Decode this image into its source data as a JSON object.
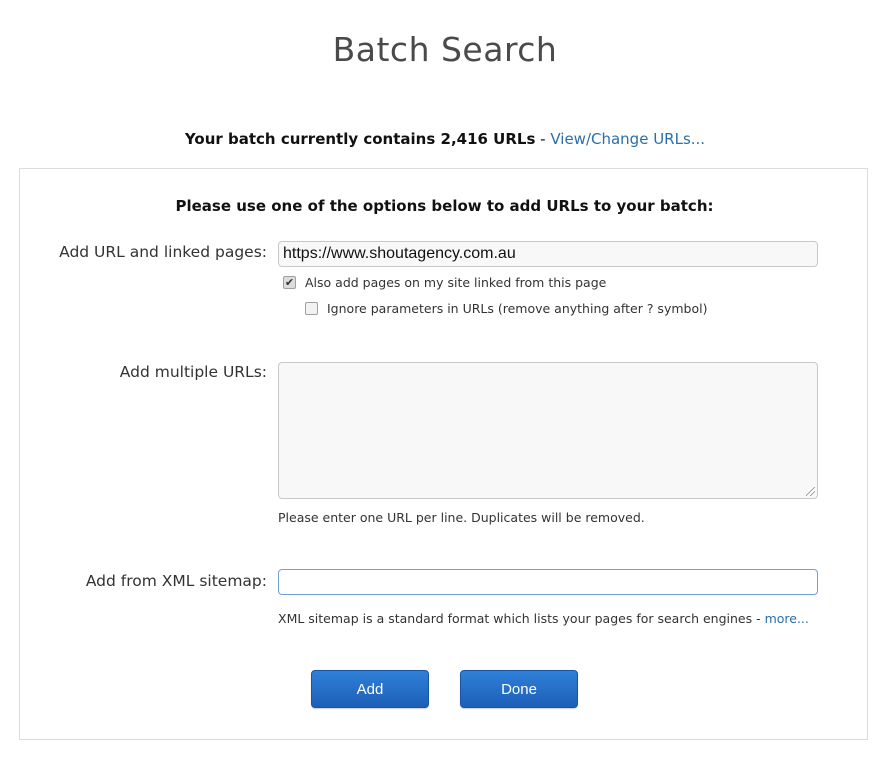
{
  "page": {
    "title": "Batch Search"
  },
  "batch_status": {
    "count_text": "Your batch currently contains 2,416 URLs",
    "separator": " - ",
    "view_change_link": "View/Change URLs..."
  },
  "form": {
    "heading": "Please use one of the options below to add URLs to your batch:",
    "url_linked": {
      "label": "Add URL and linked pages:",
      "value": "https://www.shoutagency.com.au",
      "option_linked": {
        "label": "Also add pages on my site linked from this page",
        "checked": true
      },
      "option_ignore_params": {
        "label": "Ignore parameters in URLs (remove anything after ? symbol)",
        "checked": false
      }
    },
    "multiple_urls": {
      "label": "Add multiple URLs:",
      "value": "",
      "help": "Please enter one URL per line. Duplicates will be removed."
    },
    "sitemap": {
      "label": "Add from XML sitemap:",
      "value": "",
      "help": "XML sitemap is a standard format which lists your pages for search engines - ",
      "more_link": "more..."
    },
    "buttons": {
      "add_label": "Add",
      "done_label": "Done"
    }
  },
  "colors": {
    "link": "#2a6fa8",
    "button": "#1f66c1"
  }
}
